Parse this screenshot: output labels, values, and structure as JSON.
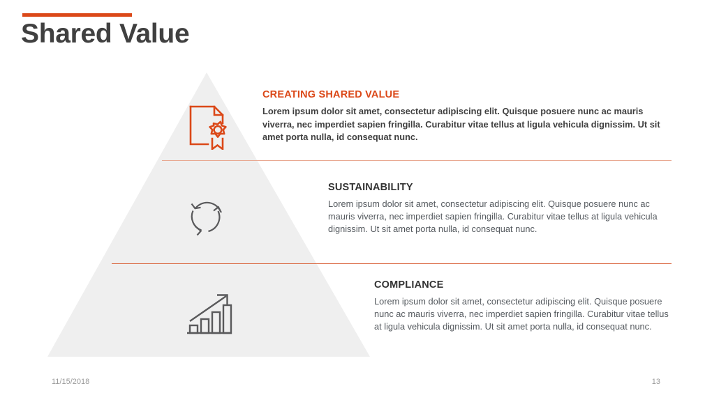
{
  "slide": {
    "title": "Shared Value",
    "accent_color": "#DB4818",
    "title_color": "#404040",
    "background_color": "#FFFFFF",
    "pyramid_fill": "#EFEFEF"
  },
  "sections": [
    {
      "heading": "CREATING SHARED VALUE",
      "body": "Lorem ipsum dolor sit amet, consectetur adipiscing elit. Quisque posuere nunc ac mauris viverra, nec imperdiet sapien fringilla. Curabitur vitae tellus at ligula vehicula dignissim. Ut sit amet porta nulla, id consequat nunc.",
      "icon": "document-award-icon",
      "icon_color": "#DB4818",
      "heading_color": "#DB4818"
    },
    {
      "heading": "SUSTAINABILITY",
      "body": "Lorem ipsum dolor sit amet, consectetur adipiscing elit. Quisque posuere nunc ac mauris viverra, nec imperdiet sapien fringilla. Curabitur vitae tellus at ligula vehicula dignissim. Ut sit amet porta nulla, id consequat nunc.",
      "icon": "recycle-arrows-icon",
      "icon_color": "#59595B",
      "heading_color": "#333333"
    },
    {
      "heading": "COMPLIANCE",
      "body": "Lorem ipsum dolor sit amet, consectetur adipiscing elit. Quisque posuere nunc ac mauris viverra, nec imperdiet sapien fringilla. Curabitur vitae tellus at ligula vehicula dignissim. Ut sit amet porta nulla, id consequat nunc.",
      "icon": "growth-bar-chart-icon",
      "icon_color": "#59595B",
      "heading_color": "#333333"
    }
  ],
  "dividers": [
    {
      "color": "#E8A68E"
    },
    {
      "color": "#D9633A"
    }
  ],
  "footer": {
    "date": "11/15/2018",
    "page_number": "13"
  }
}
